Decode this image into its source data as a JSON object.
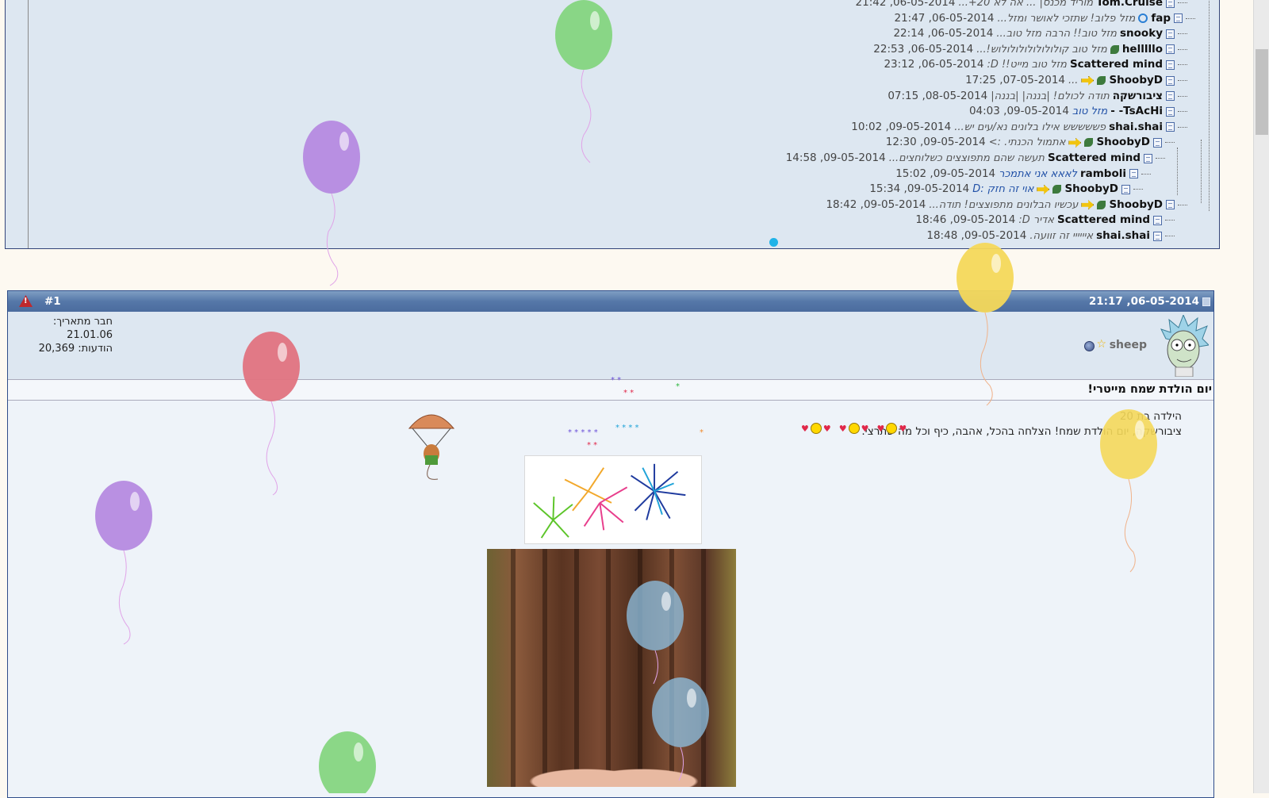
{
  "thread_tree": {
    "rows": [
      {
        "author": "Tom.Cruise",
        "title": "מוריד מכנס| ... אה לא 20+...",
        "date": "06-05-2014, 21:42",
        "icons": []
      },
      {
        "author": "fap",
        "title": "מזל פלוב! שתזכי לאושר ומזל...",
        "date": "06-05-2014, 21:47",
        "icons": [
          "q"
        ]
      },
      {
        "author": "snooky",
        "title": "מזל טוב!! הרבה מזל טוב...",
        "date": "06-05-2014, 22:14",
        "icons": []
      },
      {
        "author": "helllllo",
        "title": "מזל טוב קולולולולולולולוש!...",
        "date": "06-05-2014, 22:53",
        "icons": [
          "leaf"
        ]
      },
      {
        "author": "Scattered mind",
        "title": "מזל טוב מייט!! D:",
        "date": "06-05-2014, 23:12",
        "icons": []
      },
      {
        "author": "ShoobyD",
        "title": "...",
        "date": "07-05-2014, 17:25",
        "icons": [
          "leaf",
          "arrow"
        ]
      },
      {
        "author": "ציבורשקה",
        "title": "תודה לכולם! |בננה| |בננה|",
        "date": "08-05-2014, 07:15",
        "icons": []
      },
      {
        "author": "TsAcHi- -",
        "title": "מזל טוב",
        "date": "09-05-2014, 04:03",
        "icons": [],
        "link": true
      },
      {
        "author": "shai.shai",
        "title": "פששששש אילו בלונים נא/עים יש...",
        "date": "09-05-2014, 10:02",
        "icons": []
      },
      {
        "author": "ShoobyD",
        "title": "אתמול הכנתי. :>",
        "date": "09-05-2014, 12:30",
        "icons": [
          "leaf",
          "arrow"
        ]
      },
      {
        "author": "Scattered mind",
        "title": "תעשה שהם מתפוצצים כשלוחצים...",
        "date": "09-05-2014, 14:58",
        "icons": []
      },
      {
        "author": "ramboli",
        "title": "לאאא אני אתמכר",
        "date": "09-05-2014, 15:02",
        "icons": [],
        "link": true
      },
      {
        "author": "ShoobyD",
        "title": "אוי זה חזק :D",
        "date": "09-05-2014, 15:34",
        "icons": [
          "leaf",
          "arrow"
        ],
        "link": true
      },
      {
        "author": "ShoobyD",
        "title": "עכשיו הבלונים מתפוצצים! תודה...",
        "date": "09-05-2014, 18:42",
        "icons": [
          "leaf",
          "arrow"
        ]
      },
      {
        "author": "Scattered mind",
        "title": "אדיר D:",
        "date": "09-05-2014, 18:46",
        "icons": []
      },
      {
        "author": "shai.shai",
        "title": "איייייי זה זוועה.",
        "date": "09-05-2014, 18:48",
        "icons": []
      }
    ]
  },
  "post": {
    "date": "06-05-2014, 21:17",
    "number": "#1",
    "username": "sheep",
    "join_label": "חבר מתאריך: 21.01.06",
    "posts_label": "הודעות: 20,369",
    "title": "יום הולדת שמח מייטרי!",
    "line1": "הילדה בת 20",
    "line2": "ציבורשקה, יום הולדת שמח! הצלחה בהכל, אהבה, כיף וכל מה שתרצי."
  },
  "colors": {
    "header_bg": "#5577a8",
    "tree_bg": "#dde7f1",
    "post_bg": "#eef3f9",
    "page_bg": "#fdf9f1"
  }
}
